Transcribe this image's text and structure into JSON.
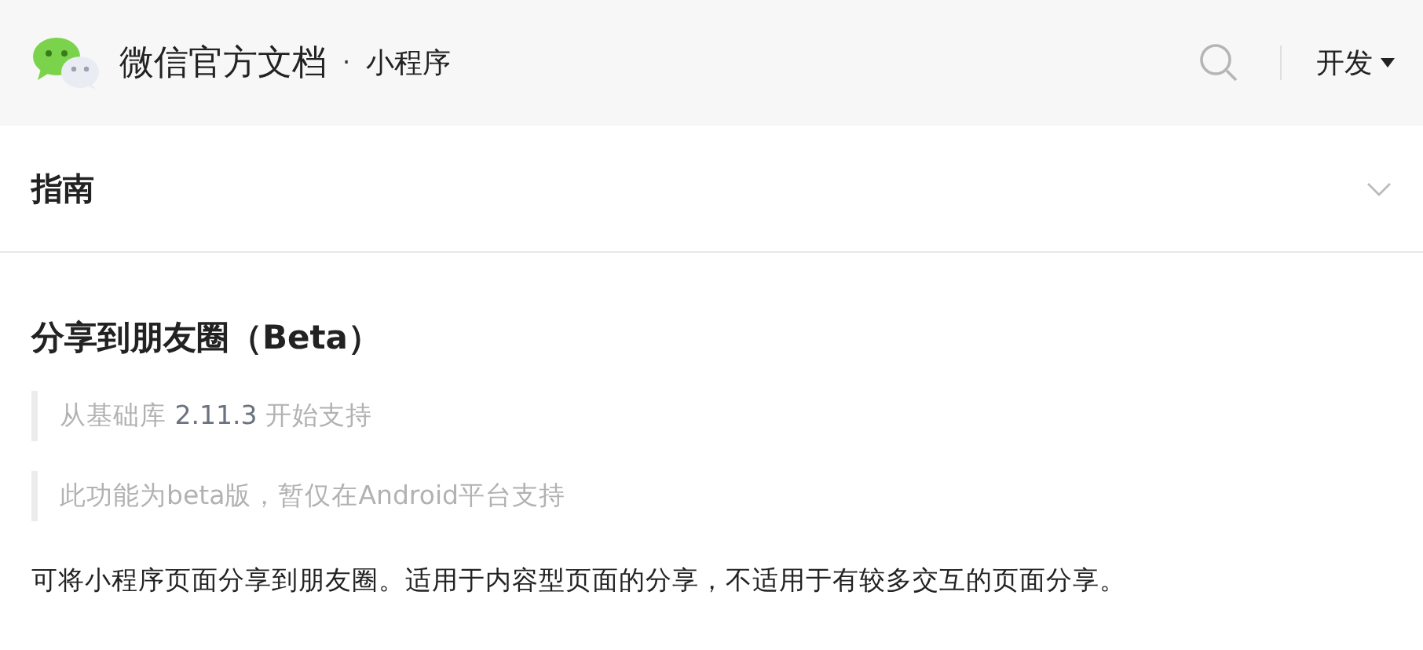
{
  "header": {
    "title": "微信官方文档",
    "separator": "·",
    "subtitle": "小程序",
    "menu": "开发"
  },
  "section": {
    "title": "指南",
    "expanded": false
  },
  "article": {
    "title": "分享到朋友圈（Beta）",
    "notes": [
      {
        "kind": "version",
        "prefix": "从基础库 ",
        "version": "2.11.3",
        "suffix": " 开始支持"
      },
      {
        "kind": "plain",
        "text": "此功能为beta版，暂仅在Android平台支持"
      }
    ],
    "body": "可将小程序页面分享到朋友圈。适用于内容型页面的分享，不适用于有较多交互的页面分享。"
  }
}
